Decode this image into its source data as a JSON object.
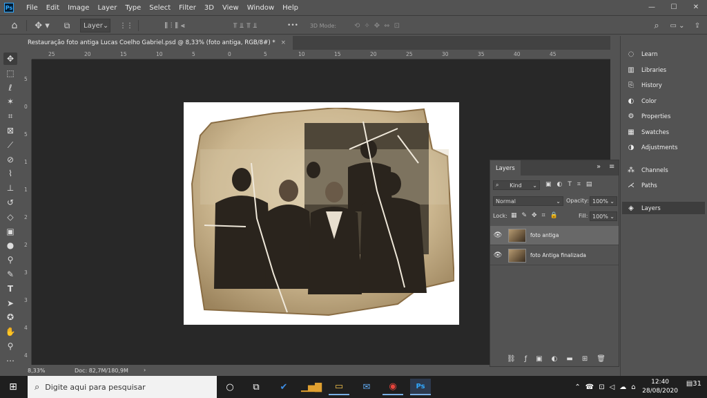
{
  "app": {
    "logo": "Ps"
  },
  "menu": [
    "File",
    "Edit",
    "Image",
    "Layer",
    "Type",
    "Select",
    "Filter",
    "3D",
    "View",
    "Window",
    "Help"
  ],
  "window_controls": {
    "minimize": "—",
    "maximize": "☐",
    "close": "✕"
  },
  "options": {
    "layer_select": "Layer",
    "mode_3d": "3D Mode:",
    "more": "•••"
  },
  "document": {
    "tab_title": "Restauração foto antiga Lucas Coelho Gabriel.psd @ 8,33% (foto antiga, RGB/8#) *",
    "close": "×",
    "zoom": "8,33%",
    "doc_size": "Doc: 82,7M/180,9M"
  },
  "ruler": {
    "h": [
      "25",
      "20",
      "15",
      "10",
      "5",
      "0",
      "5",
      "10",
      "15",
      "20",
      "25",
      "30",
      "35",
      "40",
      "45"
    ],
    "v": [
      "5",
      "0",
      "5",
      "1",
      "1",
      "2",
      "2",
      "3",
      "3",
      "4",
      "4"
    ]
  },
  "right_panels": [
    {
      "label": "Learn",
      "icon": "lightbulb-icon"
    },
    {
      "label": "Libraries",
      "icon": "library-icon"
    },
    {
      "label": "History",
      "icon": "history-icon"
    },
    {
      "label": "Color",
      "icon": "palette-icon"
    },
    {
      "label": "Properties",
      "icon": "properties-icon"
    },
    {
      "label": "Swatches",
      "icon": "grid-icon"
    },
    {
      "label": "Adjustments",
      "icon": "adjustments-icon"
    },
    {
      "label": "Channels",
      "icon": "channels-icon"
    },
    {
      "label": "Paths",
      "icon": "paths-icon"
    },
    {
      "label": "Layers",
      "icon": "layers-icon"
    }
  ],
  "layers_panel": {
    "title": "Layers",
    "filter_kind": "Kind",
    "blend_mode": "Normal",
    "opacity_label": "Opacity:",
    "opacity_value": "100%",
    "lock_label": "Lock:",
    "fill_label": "Fill:",
    "fill_value": "100%",
    "layers": [
      {
        "name": "foto antiga",
        "visible": true,
        "selected": true
      },
      {
        "name": "foto Antiga finalizada",
        "visible": true,
        "selected": false
      }
    ]
  },
  "taskbar": {
    "search_placeholder": "Digite aqui para pesquisar",
    "time": "12:40",
    "date": "28/08/2020",
    "notifications": "31"
  },
  "colors": {
    "accent": "#31a8ff",
    "panel": "#535353",
    "canvas": "#282828"
  }
}
